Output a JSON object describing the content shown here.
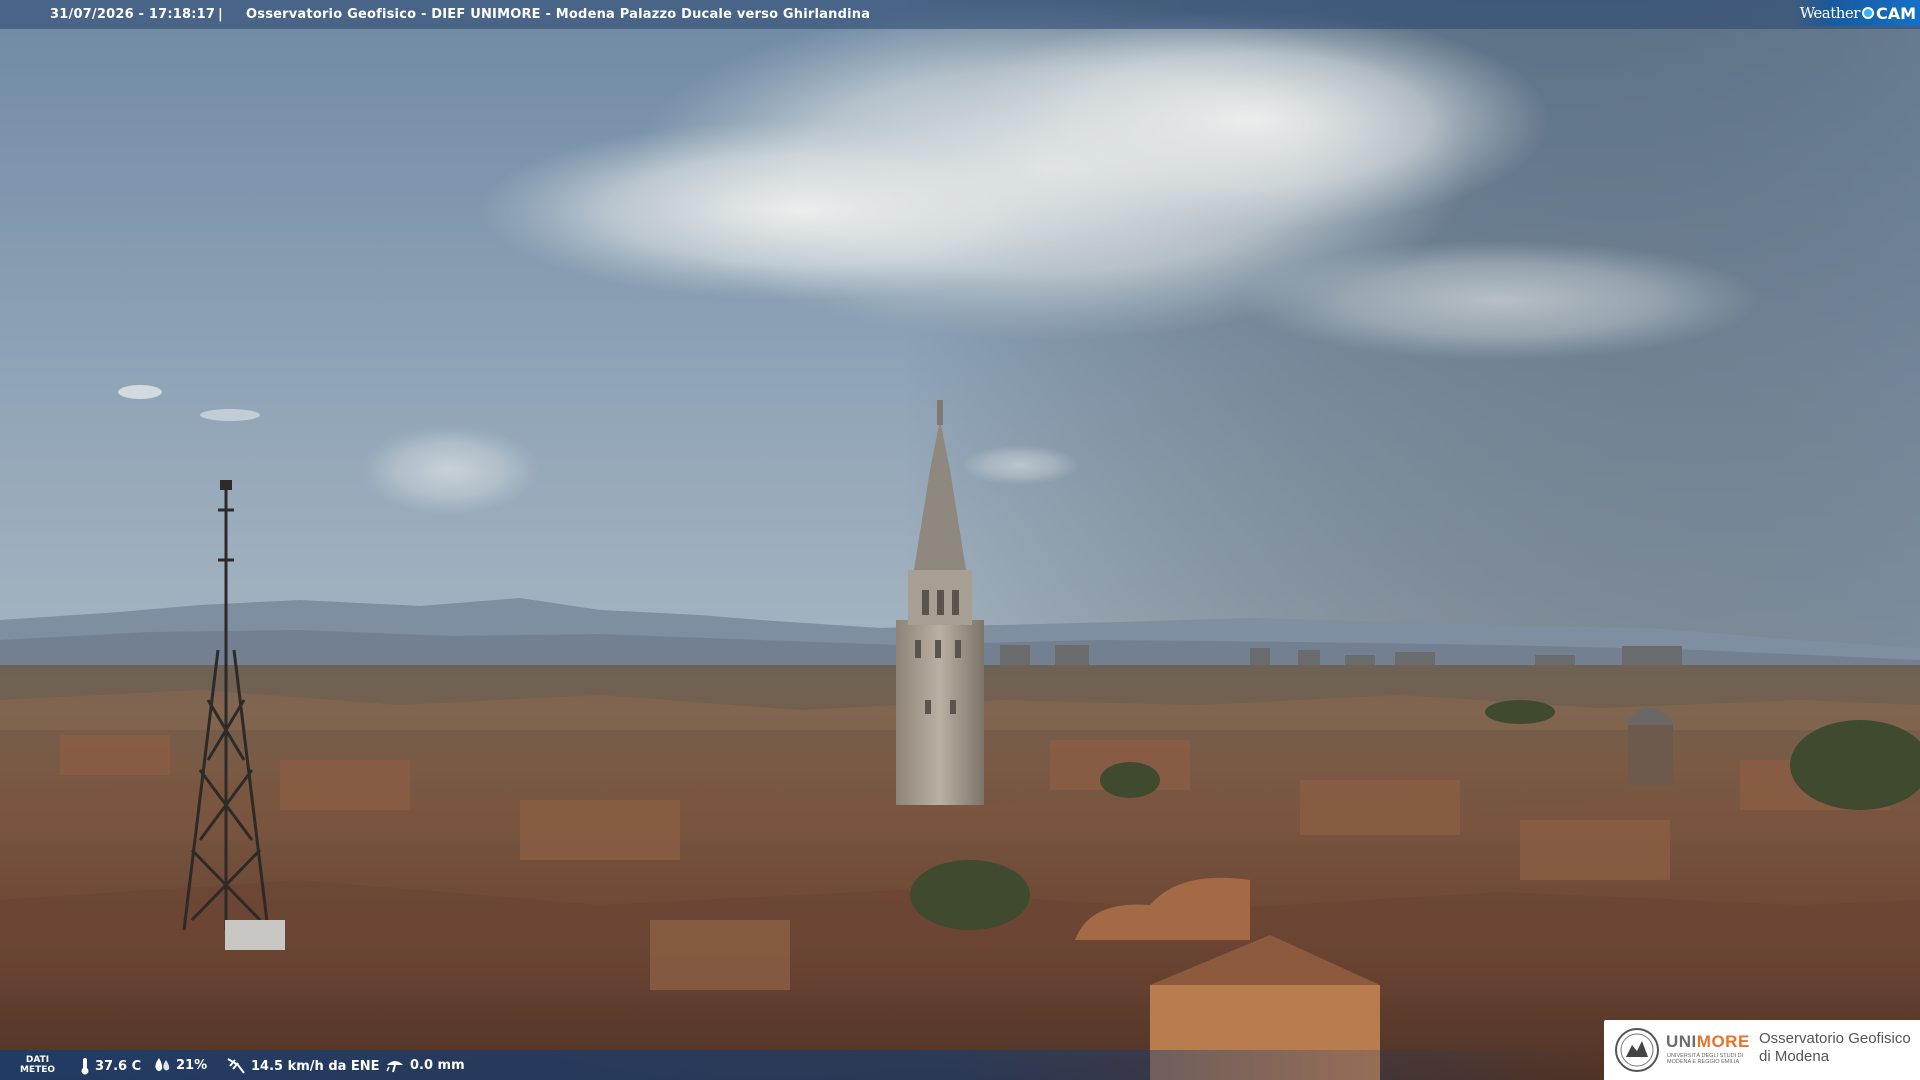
{
  "header": {
    "timestamp": "31/07/2026 - 17:18:17",
    "separator": "|",
    "caption": "Osservatorio Geofisico - DIEF UNIMORE - Modena Palazzo Ducale verso Ghirlandina",
    "brand_weather": "Weather",
    "brand_cam": "CAM"
  },
  "weather": {
    "label_line1": "DATI",
    "label_line2": "METEO",
    "temperature": "37.6 C",
    "humidity": "21%",
    "wind": "14.5 km/h da ENE",
    "rain": "0.0 mm",
    "icons": [
      "thermometer-icon",
      "humidity-icon",
      "wind-icon",
      "rain-icon"
    ]
  },
  "logo": {
    "uni_prefix": "UNI",
    "uni_suffix": "MORE",
    "uni_sub": "UNIVERSITÀ DEGLI STUDI DI MODENA E REGGIO EMILIA",
    "observatory_line1": "Osservatorio Geofisico",
    "observatory_line2": "di Modena"
  },
  "colors": {
    "bar": "#28466e",
    "brand_blue": "#1470c8",
    "unimore_orange": "#e8722a"
  }
}
